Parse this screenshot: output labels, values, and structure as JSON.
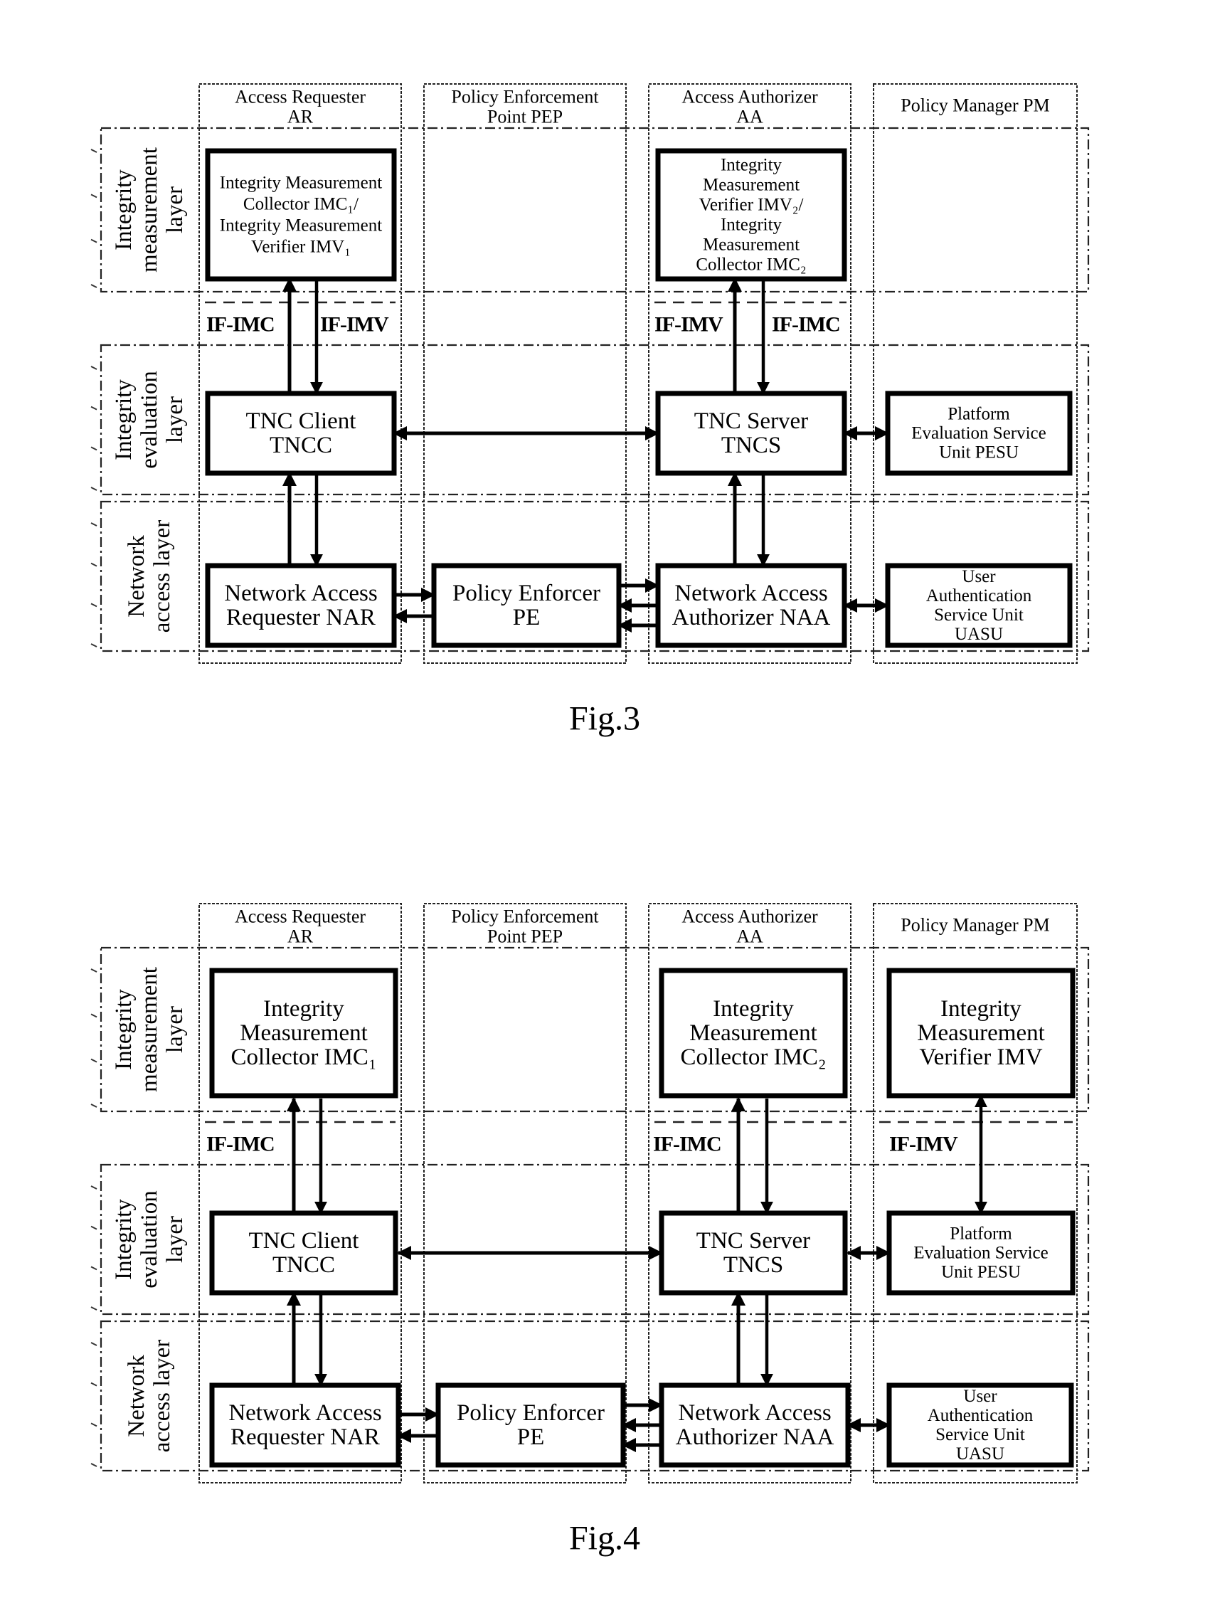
{
  "figures": [
    {
      "caption": "Fig.3",
      "columns": [
        {
          "id": "ar",
          "lines": [
            "Access Requester",
            "AR"
          ]
        },
        {
          "id": "pep",
          "lines": [
            "Policy Enforcement",
            "Point PEP"
          ]
        },
        {
          "id": "aa",
          "lines": [
            "Access Authorizer",
            "AA"
          ]
        },
        {
          "id": "pm",
          "lines": [
            "Policy Manager PM"
          ]
        }
      ],
      "layers": [
        {
          "id": "measurement",
          "lines": [
            "Integrity",
            "measurement",
            "layer"
          ]
        },
        {
          "id": "evaluation",
          "lines": [
            "Integrity",
            "evaluation",
            "layer"
          ]
        },
        {
          "id": "network",
          "lines": [
            "Network",
            "access layer"
          ]
        }
      ],
      "interfaces": [
        "IF-IMC",
        "IF-IMV",
        "IF-IMV",
        "IF-IMC"
      ],
      "boxes": {
        "imc_imv_1": [
          "Integrity Measurement",
          "Collector IMC₁/",
          "Integrity Measurement",
          "Verifier IMV₁"
        ],
        "imv_imc_2": [
          "Integrity",
          "Measurement",
          "Verifier IMV₂/",
          "Integrity",
          "Measurement",
          "Collector IMC₂"
        ],
        "tncc": [
          "TNC Client",
          "TNCC"
        ],
        "tncs": [
          "TNC Server",
          "TNCS"
        ],
        "pesu": [
          "Platform",
          "Evaluation Service",
          "Unit PESU"
        ],
        "nar": [
          "Network Access",
          "Requester NAR"
        ],
        "pe": [
          "Policy Enforcer",
          "PE"
        ],
        "naa": [
          "Network Access",
          "Authorizer NAA"
        ],
        "uasu": [
          "User",
          "Authentication",
          "Service Unit",
          "UASU"
        ]
      }
    },
    {
      "caption": "Fig.4",
      "columns": [
        {
          "id": "ar",
          "lines": [
            "Access Requester",
            "AR"
          ]
        },
        {
          "id": "pep",
          "lines": [
            "Policy Enforcement",
            "Point PEP"
          ]
        },
        {
          "id": "aa",
          "lines": [
            "Access Authorizer",
            "AA"
          ]
        },
        {
          "id": "pm",
          "lines": [
            "Policy Manager PM"
          ]
        }
      ],
      "layers": [
        {
          "id": "measurement",
          "lines": [
            "Integrity",
            "measurement",
            "layer"
          ]
        },
        {
          "id": "evaluation",
          "lines": [
            "Integrity",
            "evaluation",
            "layer"
          ]
        },
        {
          "id": "network",
          "lines": [
            "Network",
            "access layer"
          ]
        }
      ],
      "interfaces": [
        "IF-IMC",
        "IF-IMC",
        "IF-IMV"
      ],
      "boxes": {
        "imc_1": [
          "Integrity",
          "Measurement",
          "Collector IMC₁"
        ],
        "imc_2": [
          "Integrity",
          "Measurement",
          "Collector IMC₂"
        ],
        "imv": [
          "Integrity",
          "Measurement",
          "Verifier IMV"
        ],
        "tncc": [
          "TNC Client",
          "TNCC"
        ],
        "tncs": [
          "TNC Server",
          "TNCS"
        ],
        "pesu": [
          "Platform",
          "Evaluation Service",
          "Unit PESU"
        ],
        "nar": [
          "Network Access",
          "Requester NAR"
        ],
        "pe": [
          "Policy Enforcer",
          "PE"
        ],
        "naa": [
          "Network Access",
          "Authorizer NAA"
        ],
        "uasu": [
          "User",
          "Authentication",
          "Service Unit",
          "UASU"
        ]
      }
    }
  ]
}
